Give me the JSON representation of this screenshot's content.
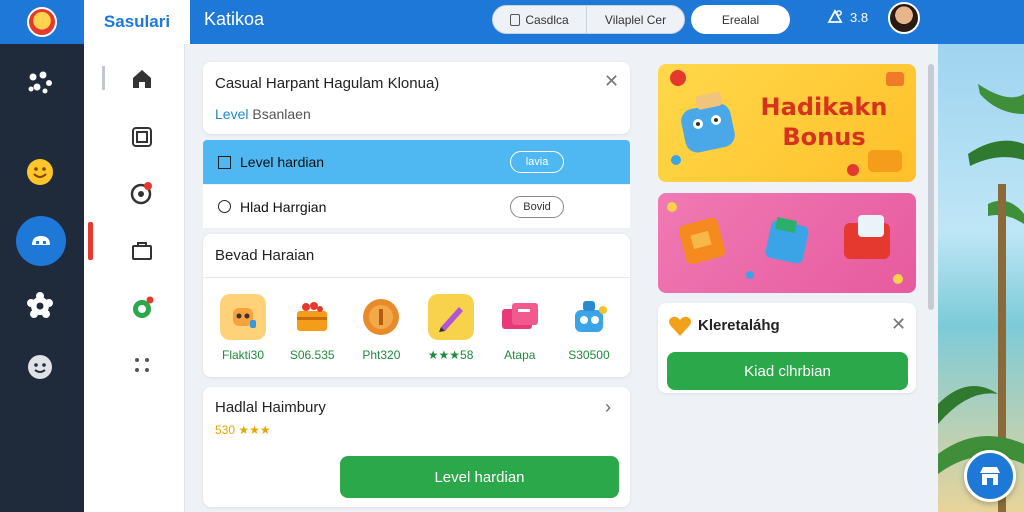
{
  "header": {
    "brand": "Sasulari",
    "title": "Katikoa",
    "pill_left": "Casdlca",
    "pill_right": "Vilaplel Cer",
    "pill_single": "Erealal",
    "notif_count": "3.8"
  },
  "card_level": {
    "title": "Casual Harpant Hagulam Klonua)",
    "sub_key": "Level",
    "sub_value": "Bsanlaen"
  },
  "options": [
    {
      "label": "Level hardian",
      "button": "lavia"
    },
    {
      "label": "Hlad Harrgian",
      "button": "Bovid"
    }
  ],
  "rewards": {
    "title": "Bevad Haraian",
    "items": [
      {
        "label": "Flakti30",
        "icon": "robot-icon"
      },
      {
        "label": "S06.535",
        "icon": "treasure-chest-icon"
      },
      {
        "label": "Pht320",
        "icon": "coin-icon"
      },
      {
        "label": "★★★58",
        "icon": "pencil-icon"
      },
      {
        "label": "Atapa",
        "icon": "ticket-icon"
      },
      {
        "label": "S30500",
        "icon": "toy-robot-icon"
      }
    ]
  },
  "card_history": {
    "title": "Hadlal Haimbury",
    "stars": "530 ★★★",
    "button": "Level hardian"
  },
  "promo": {
    "banner_text": "Hadikakn Bonus",
    "card_title": "Kleretaláhg",
    "card_button": "Kiad clhrbian"
  },
  "colors": {
    "primary": "#1e78d8",
    "active_row": "#4fb8f2",
    "green": "#2aa84a",
    "rail": "#1f2a3a"
  }
}
